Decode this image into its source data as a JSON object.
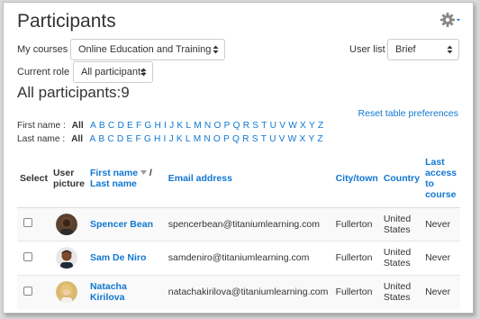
{
  "page": {
    "title": "Participants"
  },
  "filters": {
    "my_courses_label": "My courses",
    "my_courses_value": "Online Education and Training",
    "user_list_label": "User list",
    "user_list_value": "Brief",
    "current_role_label": "Current role",
    "current_role_value": "All participants"
  },
  "summary": {
    "heading": "All participants:9"
  },
  "reset_link": "Reset table preferences",
  "initials": {
    "first_label": "First name :",
    "last_label": "Last name :",
    "all": "All",
    "letters": [
      "A",
      "B",
      "C",
      "D",
      "E",
      "F",
      "G",
      "H",
      "I",
      "J",
      "K",
      "L",
      "M",
      "N",
      "O",
      "P",
      "Q",
      "R",
      "S",
      "T",
      "U",
      "V",
      "W",
      "X",
      "Y",
      "Z"
    ]
  },
  "table": {
    "headers": {
      "select": "Select",
      "user_picture": "User picture",
      "first_name": "First name",
      "slash": "/",
      "last_name": "Last name",
      "email": "Email address",
      "city": "City/town",
      "country": "Country",
      "last_access": "Last access to course"
    },
    "rows": [
      {
        "name": "Spencer Bean",
        "email": "spencerbean@titaniumlearning.com",
        "city": "Fullerton",
        "country": "United States",
        "last_access": "Never",
        "avatar": "dark"
      },
      {
        "name": "Sam De Niro",
        "email": "samdeniro@titaniumlearning.com",
        "city": "Fullerton",
        "country": "United States",
        "last_access": "Never",
        "avatar": "medium"
      },
      {
        "name": "Natacha Kirilova",
        "email": "natachakirilova@titaniumlearning.com",
        "city": "Fullerton",
        "country": "United States",
        "last_access": "Never",
        "avatar": "blonde"
      }
    ]
  },
  "colors": {
    "link": "#1177d1",
    "text": "#333333",
    "gear": "#888888"
  }
}
